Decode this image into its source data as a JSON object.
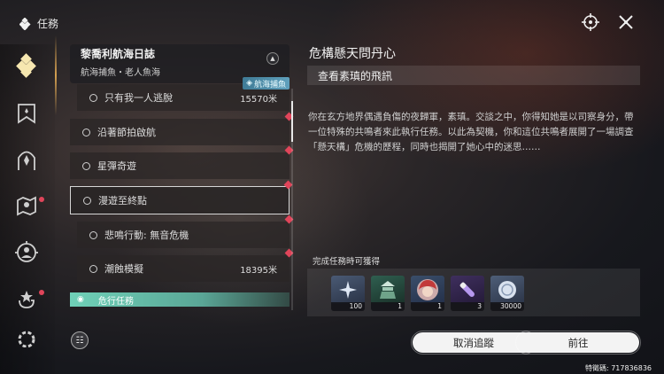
{
  "header": {
    "title": "任務",
    "icons": [
      "target-icon",
      "close-x-icon"
    ]
  },
  "sidebar": {
    "items": [
      {
        "name": "quest-diamond-icon",
        "active": true,
        "badge": false
      },
      {
        "name": "bookmark-icon",
        "active": false,
        "badge": false
      },
      {
        "name": "arch-icon",
        "active": false,
        "badge": false
      },
      {
        "name": "map-icon",
        "active": false,
        "badge": true
      },
      {
        "name": "crosshair-person-icon",
        "active": false,
        "badge": false
      },
      {
        "name": "return-star-icon",
        "active": false,
        "badge": true
      },
      {
        "name": "gear-icon",
        "active": false,
        "badge": false
      }
    ]
  },
  "quest_list": {
    "group_title": "黎喬利航海日誌",
    "group_subtitle": "航海捕魚・老人魚海",
    "items": [
      {
        "label": "只有我一人逃脫",
        "distance": "15570米",
        "tag": "航海捕魚",
        "indent": true,
        "selected": false,
        "marker": true
      },
      {
        "label": "沿著節拍啟航",
        "distance": "",
        "indent": false,
        "selected": false,
        "marker": true
      },
      {
        "label": "星彈奇遊",
        "distance": "",
        "indent": false,
        "selected": false,
        "marker": true
      },
      {
        "label": "漫遊至終點",
        "distance": "",
        "indent": false,
        "selected": true,
        "marker": true
      },
      {
        "label": "悲鳴行動: 無音危機",
        "distance": "",
        "indent": true,
        "selected": false,
        "marker": true
      },
      {
        "label": "潮蝕模擬",
        "distance": "18395米",
        "indent": true,
        "selected": false,
        "marker": true
      }
    ],
    "category": "危行任務"
  },
  "detail": {
    "title": "危構懸天問丹心",
    "subtask": "查看素瑱的飛訊",
    "description": "你在玄方地界偶遇負傷的夜歸軍，素瑱。交談之中，你得知她是以司察身分，帶一位特殊的共鳴者來此執行任務。以此為契機，你和這位共鳴者展開了一場調查「懸天構」危機的歷程，同時也揭開了她心中的迷思……",
    "reward_label": "完成任務時可獲得",
    "rewards": [
      {
        "name": "star-shard-icon",
        "qty": "100",
        "color": "#8aa6c8"
      },
      {
        "name": "tower-icon",
        "qty": "1",
        "color": "#2f6b55"
      },
      {
        "name": "portrait-icon",
        "qty": "1",
        "color": "#b33a3a"
      },
      {
        "name": "vial-icon",
        "qty": "3",
        "color": "#6b4aa0"
      },
      {
        "name": "coin-icon",
        "qty": "30000",
        "color": "#a8b4c8"
      }
    ]
  },
  "actions": {
    "cancel_track": "取消追蹤",
    "go": "前往"
  },
  "footer": {
    "uid": "特徵碼: 717836836"
  }
}
